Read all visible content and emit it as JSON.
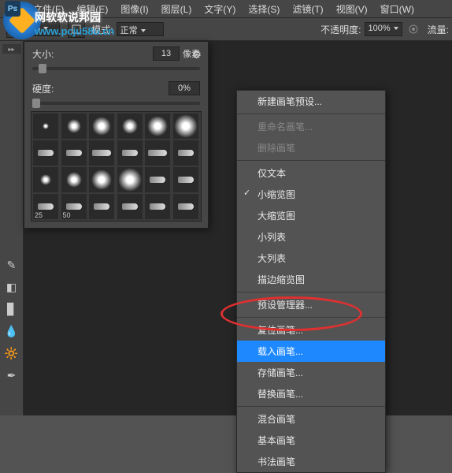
{
  "menubar": {
    "items": [
      "文件(F)",
      "编辑(E)",
      "图像(I)",
      "图层(L)",
      "文字(Y)",
      "选择(S)",
      "滤镜(T)",
      "视图(V)",
      "窗口(W)"
    ]
  },
  "watermark": {
    "text": "网软软说邦园",
    "url": "www.pcju58u.cn"
  },
  "options": {
    "brush_size": "13",
    "mode_label": "模式:",
    "mode_value": "正常",
    "opacity_label": "不透明度:",
    "opacity_value": "100%",
    "flow_label": "流量:"
  },
  "brush_panel": {
    "size_label": "大小:",
    "size_value": "13",
    "size_unit": "像素",
    "hardness_label": "硬度:",
    "hardness_value": "0%",
    "preset_labels": [
      "25",
      "50"
    ]
  },
  "context_menu": {
    "items": [
      {
        "label": "新建画笔预设...",
        "type": "item"
      },
      {
        "type": "sep"
      },
      {
        "label": "重命名画笔...",
        "type": "item",
        "disabled": true
      },
      {
        "label": "删除画笔",
        "type": "item",
        "disabled": true
      },
      {
        "type": "sep"
      },
      {
        "label": "仅文本",
        "type": "item"
      },
      {
        "label": "小缩览图",
        "type": "item",
        "checked": true
      },
      {
        "label": "大缩览图",
        "type": "item"
      },
      {
        "label": "小列表",
        "type": "item"
      },
      {
        "label": "大列表",
        "type": "item"
      },
      {
        "label": "描边缩览图",
        "type": "item"
      },
      {
        "type": "sep"
      },
      {
        "label": "预设管理器...",
        "type": "item"
      },
      {
        "type": "sep"
      },
      {
        "label": "复位画笔...",
        "type": "item"
      },
      {
        "label": "载入画笔...",
        "type": "item",
        "highlighted": true
      },
      {
        "label": "存储画笔...",
        "type": "item"
      },
      {
        "label": "替换画笔...",
        "type": "item"
      },
      {
        "type": "sep"
      },
      {
        "label": "混合画笔",
        "type": "item"
      },
      {
        "label": "基本画笔",
        "type": "item"
      },
      {
        "label": "书法画笔",
        "type": "item"
      }
    ]
  }
}
